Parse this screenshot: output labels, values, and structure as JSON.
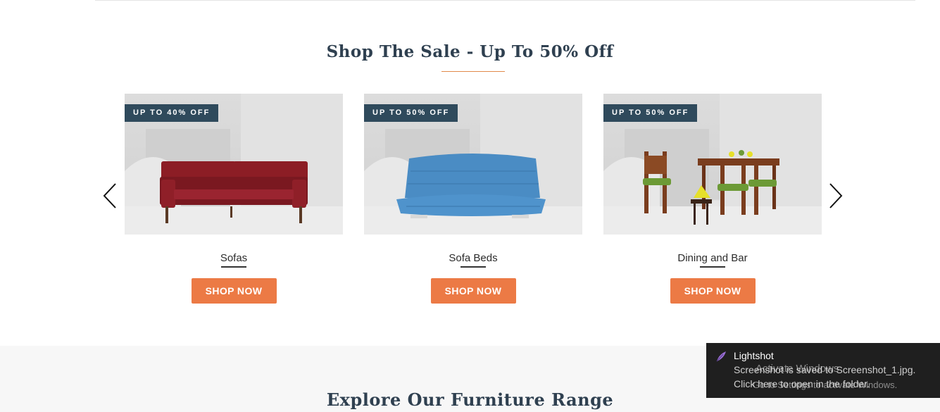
{
  "sale_section": {
    "title": "Shop The Sale - Up To 50% Off",
    "cards": [
      {
        "badge": "UP TO 40% OFF",
        "name": "Sofas",
        "button": "SHOP NOW",
        "image": "red-sofa-image",
        "product_color": "#8c1d25"
      },
      {
        "badge": "UP TO 50% OFF",
        "name": "Sofa Beds",
        "button": "SHOP NOW",
        "image": "blue-sofa-bed-image",
        "product_color": "#4a8cc4"
      },
      {
        "badge": "UP TO 50% OFF",
        "name": "Dining and Bar",
        "button": "SHOP NOW",
        "image": "dining-set-image",
        "product_color": "#7a3d1e"
      }
    ],
    "prev_icon": "chevron-left-icon",
    "next_icon": "chevron-right-icon"
  },
  "explore_section": {
    "title": "Explore Our Furniture Range"
  },
  "notification": {
    "app": "Lightshot",
    "line1": "Screenshot is saved to Screenshot_1.jpg.",
    "line2": "Click here to open in the folder.",
    "watermark_line1": "Activate Windows",
    "watermark_line2": "Go to Settings to activate Windows.",
    "icon": "feather-icon"
  },
  "colors": {
    "accent": "#ec7a45",
    "badge": "#2f4a5c",
    "heading": "#2f4050"
  }
}
